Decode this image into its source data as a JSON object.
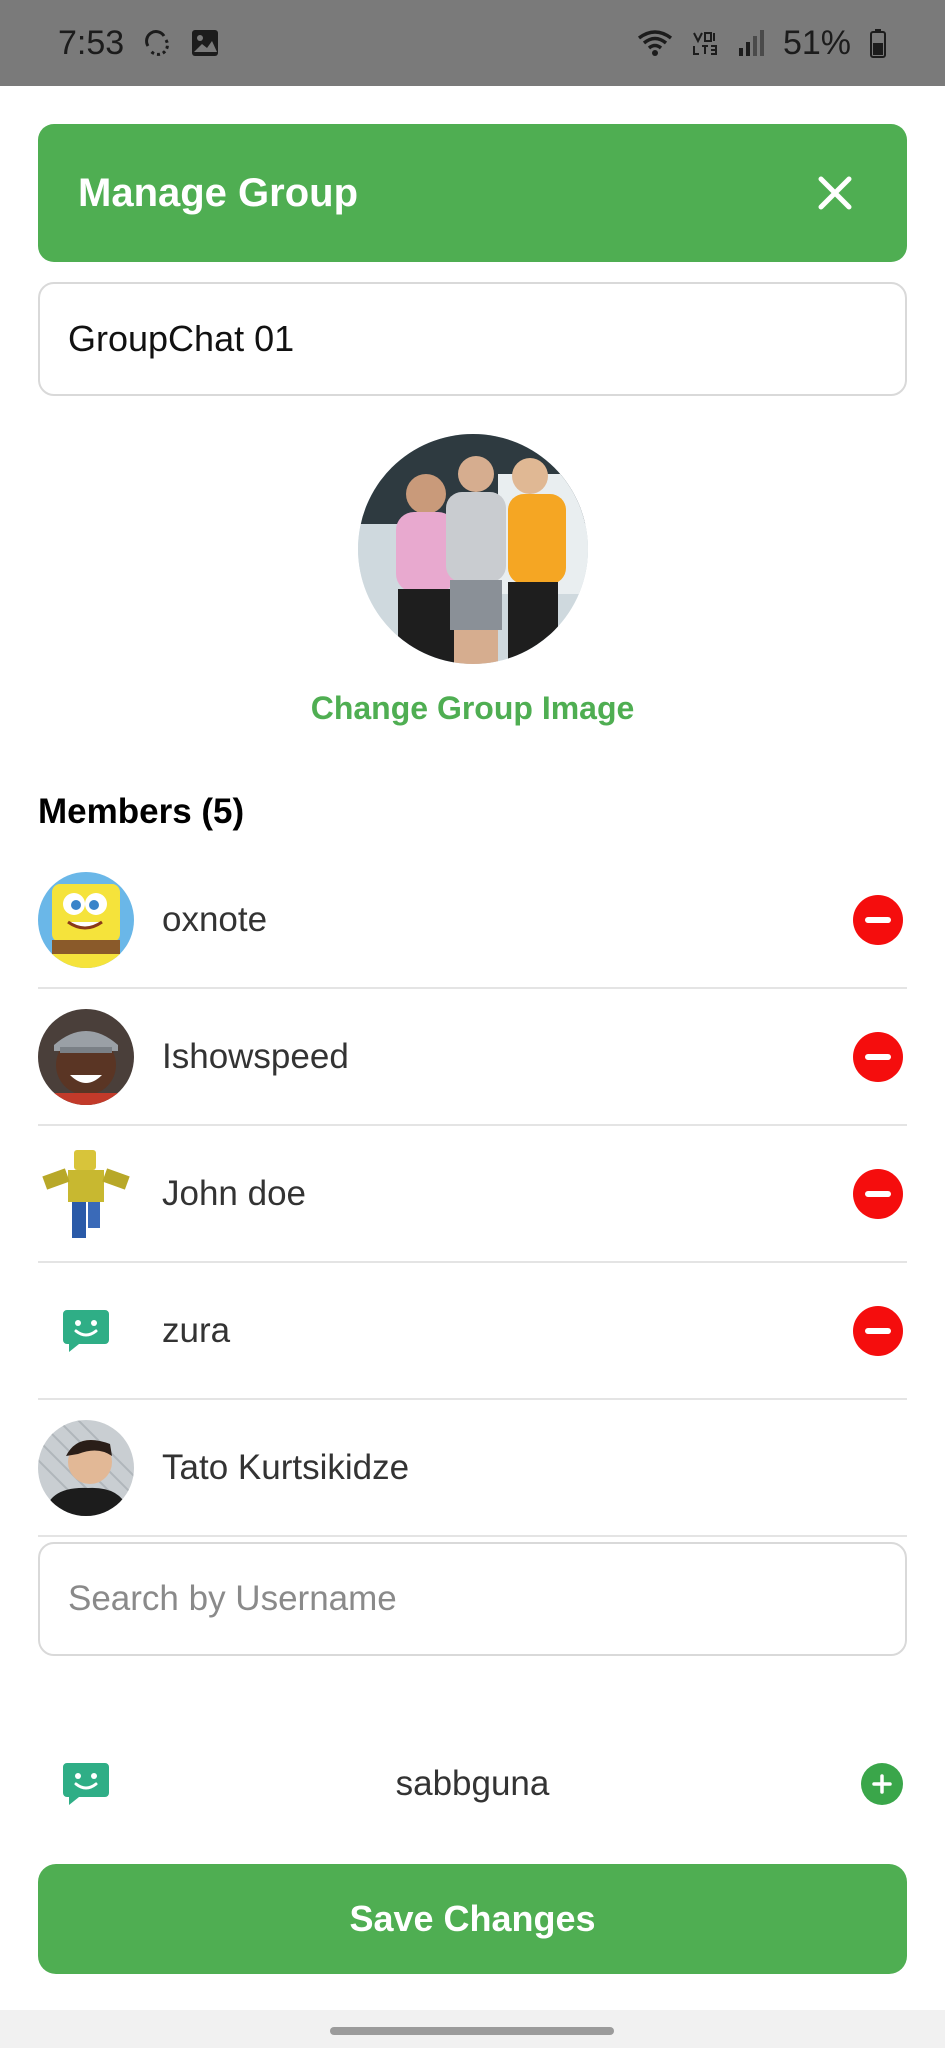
{
  "status_bar": {
    "time": "7:53",
    "battery": "51%",
    "icons": [
      "sync-icon",
      "image-icon",
      "wifi-icon",
      "volte-icon",
      "signal-icon",
      "battery-icon"
    ]
  },
  "header": {
    "title": "Manage Group",
    "close_icon": "close-icon"
  },
  "group": {
    "name_value": "GroupChat 01",
    "change_image_label": "Change Group Image"
  },
  "members": {
    "title": "Members (5)",
    "items": [
      {
        "name": "oxnote",
        "removable": true
      },
      {
        "name": "Ishowspeed",
        "removable": true
      },
      {
        "name": "John doe",
        "removable": true
      },
      {
        "name": "zura",
        "removable": true
      },
      {
        "name": "Tato Kurtsikidze",
        "removable": false
      }
    ]
  },
  "search": {
    "placeholder": "Search by Username",
    "value": ""
  },
  "search_results": [
    {
      "name": "sabbguna"
    }
  ],
  "actions": {
    "save_label": "Save Changes"
  },
  "colors": {
    "accent": "#4fae52",
    "remove": "#f50d0d",
    "add": "#3aa64a",
    "status_bar": "#7a7a7a"
  }
}
